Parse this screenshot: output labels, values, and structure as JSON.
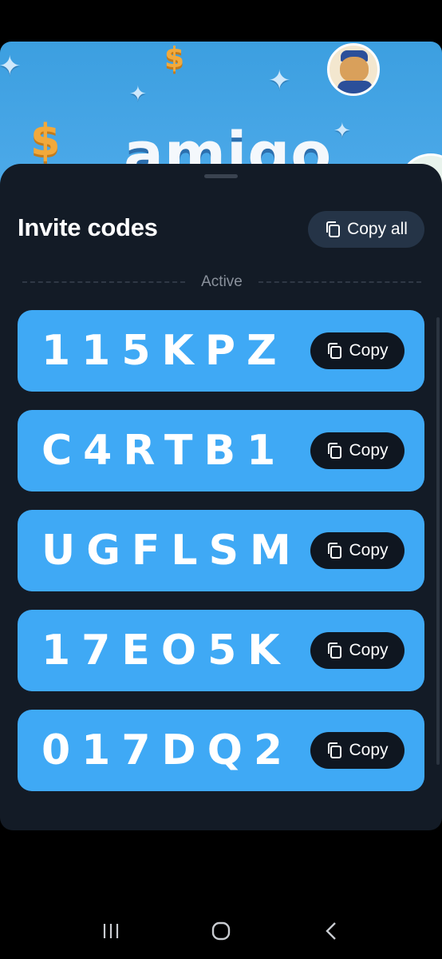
{
  "hero": {
    "logo_text": "amigo",
    "coin_symbol": "$",
    "sparkle_symbol": "✦"
  },
  "sheet": {
    "title": "Invite codes",
    "copy_all_label": "Copy all",
    "section_label": "Active",
    "codes": [
      {
        "code": "115KPZ",
        "copy_label": "Copy"
      },
      {
        "code": "C4RTB1",
        "copy_label": "Copy"
      },
      {
        "code": "UGFLSM",
        "copy_label": "Copy"
      },
      {
        "code": "17EO5K",
        "copy_label": "Copy"
      },
      {
        "code": "017DQ2",
        "copy_label": "Copy"
      }
    ]
  },
  "icons": {
    "copy": "copy-icon",
    "recent_apps": "recent-apps-icon",
    "home": "home-icon",
    "back": "back-icon"
  },
  "colors": {
    "sheet_bg": "#131b26",
    "card_bg": "#3fa9f5",
    "copy_button_bg": "#0f1620",
    "copy_all_bg": "#253447"
  }
}
